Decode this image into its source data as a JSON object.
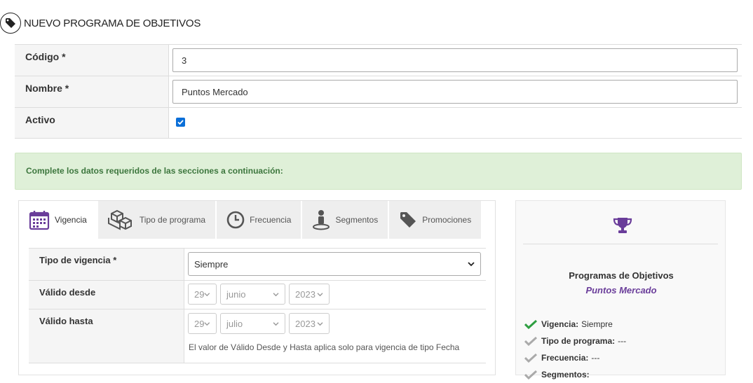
{
  "header": {
    "title": "NUEVO PROGRAMA DE OBJETIVOS",
    "icon": "tag-icon"
  },
  "form": {
    "codigo": {
      "label": "Código *",
      "value": "3"
    },
    "nombre": {
      "label": "Nombre *",
      "value": "Puntos Mercado"
    },
    "activo": {
      "label": "Activo",
      "checked": true
    }
  },
  "alert": {
    "text": "Complete los datos requeridos de las secciones a continuación:"
  },
  "tabs": [
    {
      "label": "Vigencia",
      "icon": "calendar-icon",
      "active": true
    },
    {
      "label": "Tipo de programa",
      "icon": "boxes-icon",
      "active": false
    },
    {
      "label": "Frecuencia",
      "icon": "clock-icon",
      "active": false
    },
    {
      "label": "Segmentos",
      "icon": "person-pin-icon",
      "active": false
    },
    {
      "label": "Promociones",
      "icon": "tag-icon",
      "active": false
    }
  ],
  "vigencia": {
    "tipo": {
      "label": "Tipo de vigencia *",
      "value": "Siempre"
    },
    "desde": {
      "label": "Válido desde",
      "day": "29",
      "month": "junio",
      "year": "2023"
    },
    "hasta": {
      "label": "Válido hasta",
      "day": "29",
      "month": "julio",
      "year": "2023"
    },
    "help": "El valor de Válido Desde y Hasta aplica solo para vigencia de tipo Fecha"
  },
  "summary": {
    "icon": "trophy-icon",
    "title": "Programas de Objetivos",
    "subtitle": "Puntos Mercado",
    "items": [
      {
        "label": "Vigencia:",
        "value": "Siempre",
        "done": true
      },
      {
        "label": "Tipo de programa:",
        "value": "---",
        "done": false
      },
      {
        "label": "Frecuencia:",
        "value": "---",
        "done": false
      },
      {
        "label": "Segmentos:",
        "value": "",
        "done": false
      }
    ]
  },
  "colors": {
    "accent": "#6a3d9a",
    "success_bg": "#dff0d8",
    "success_text": "#3c763d",
    "check_green": "#2e9e41",
    "check_gray": "#aaaaaa",
    "checkbox_blue": "#0b6fd8"
  }
}
